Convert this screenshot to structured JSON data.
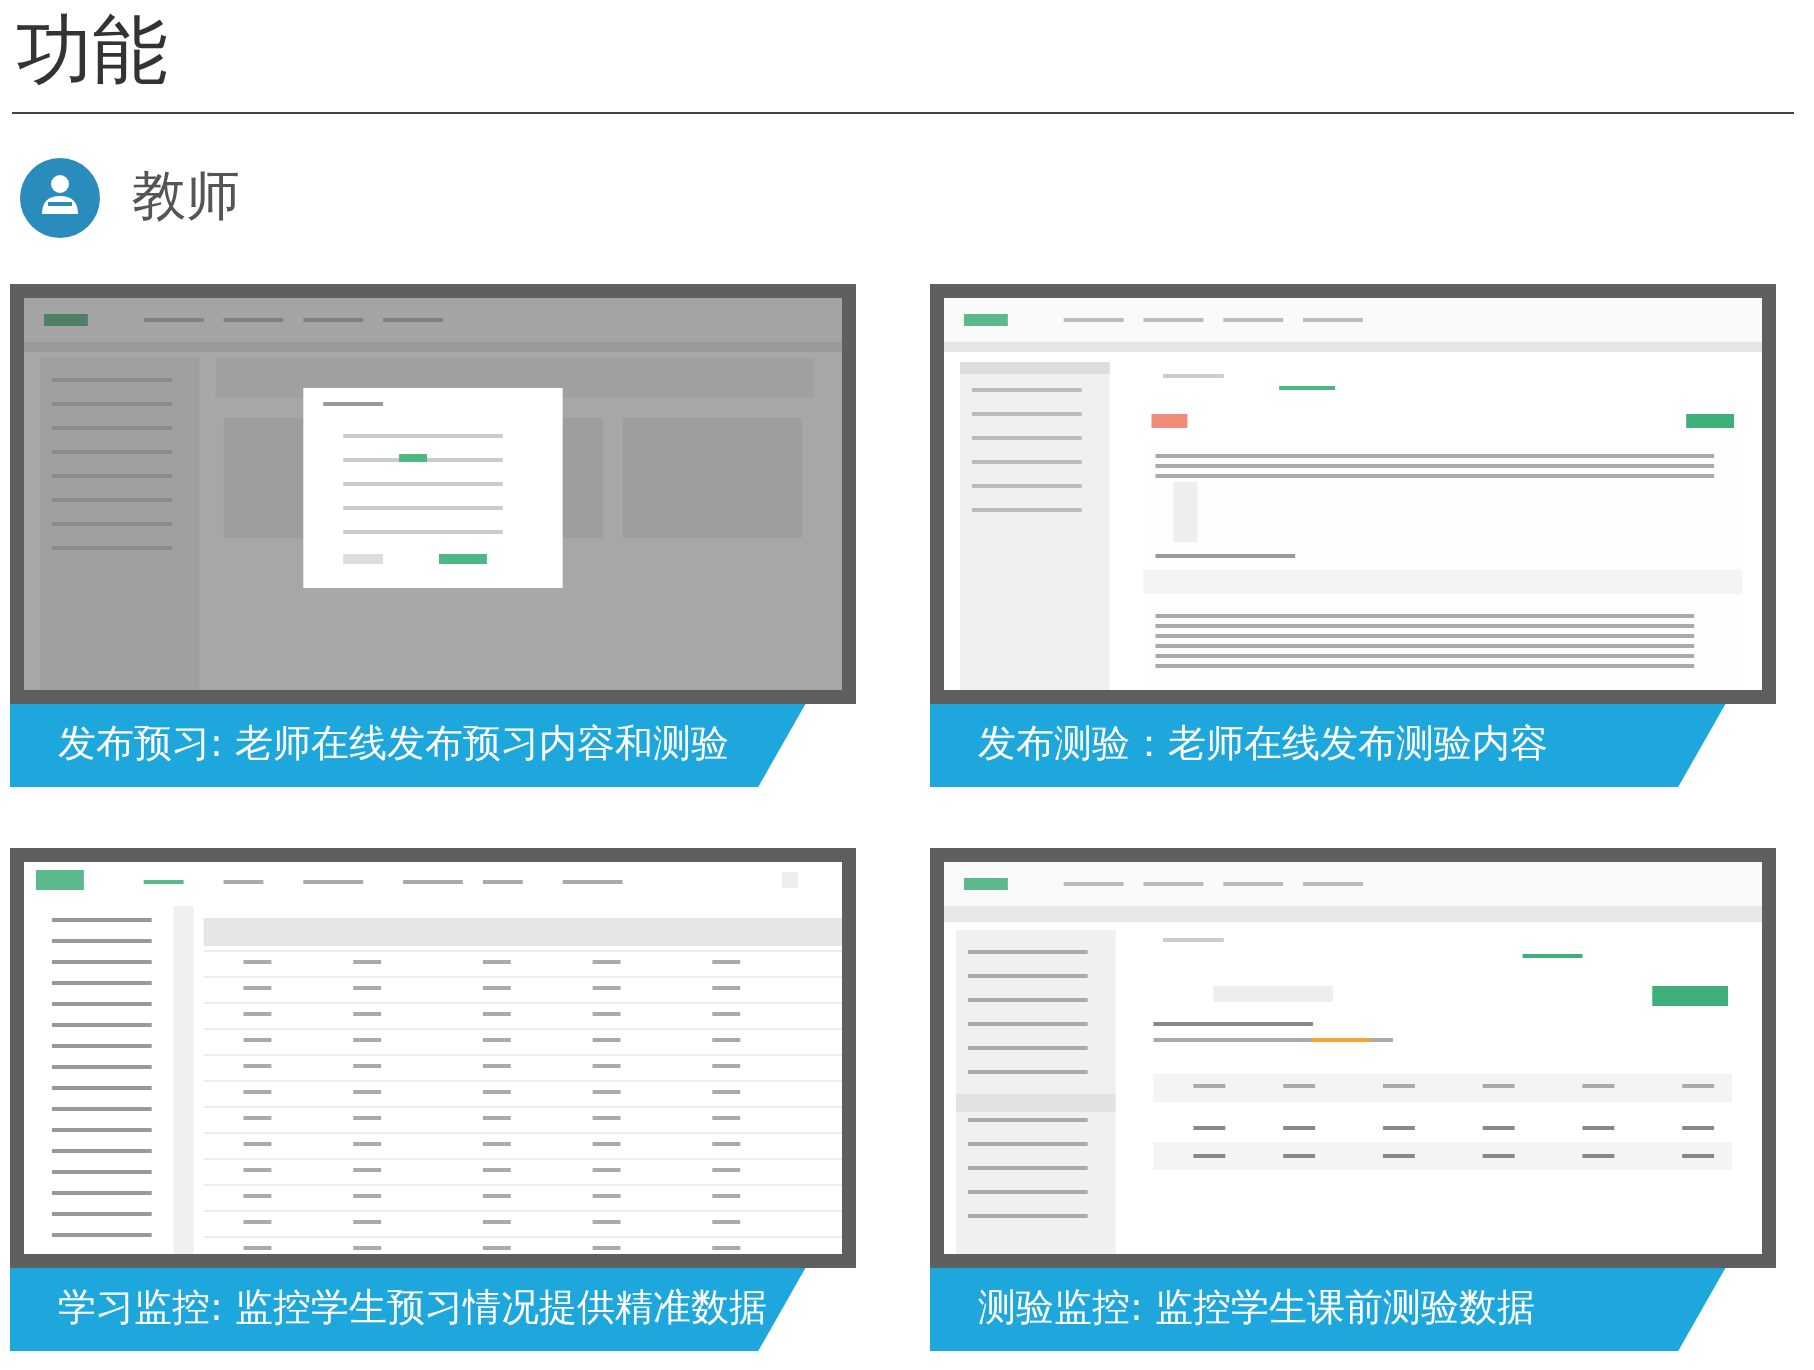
{
  "page_title": "功能",
  "section": {
    "title": "教师"
  },
  "features": [
    {
      "kind": "modal",
      "caption": "发布预习: 老师在线发布预习内容和测验"
    },
    {
      "kind": "question-list",
      "caption": "发布测验：老师在线发布测验内容"
    },
    {
      "kind": "table",
      "caption": "学习监控: 监控学生预习情况提供精准数据"
    },
    {
      "kind": "stats",
      "caption": "测验监控: 监控学生课前测验数据"
    }
  ]
}
